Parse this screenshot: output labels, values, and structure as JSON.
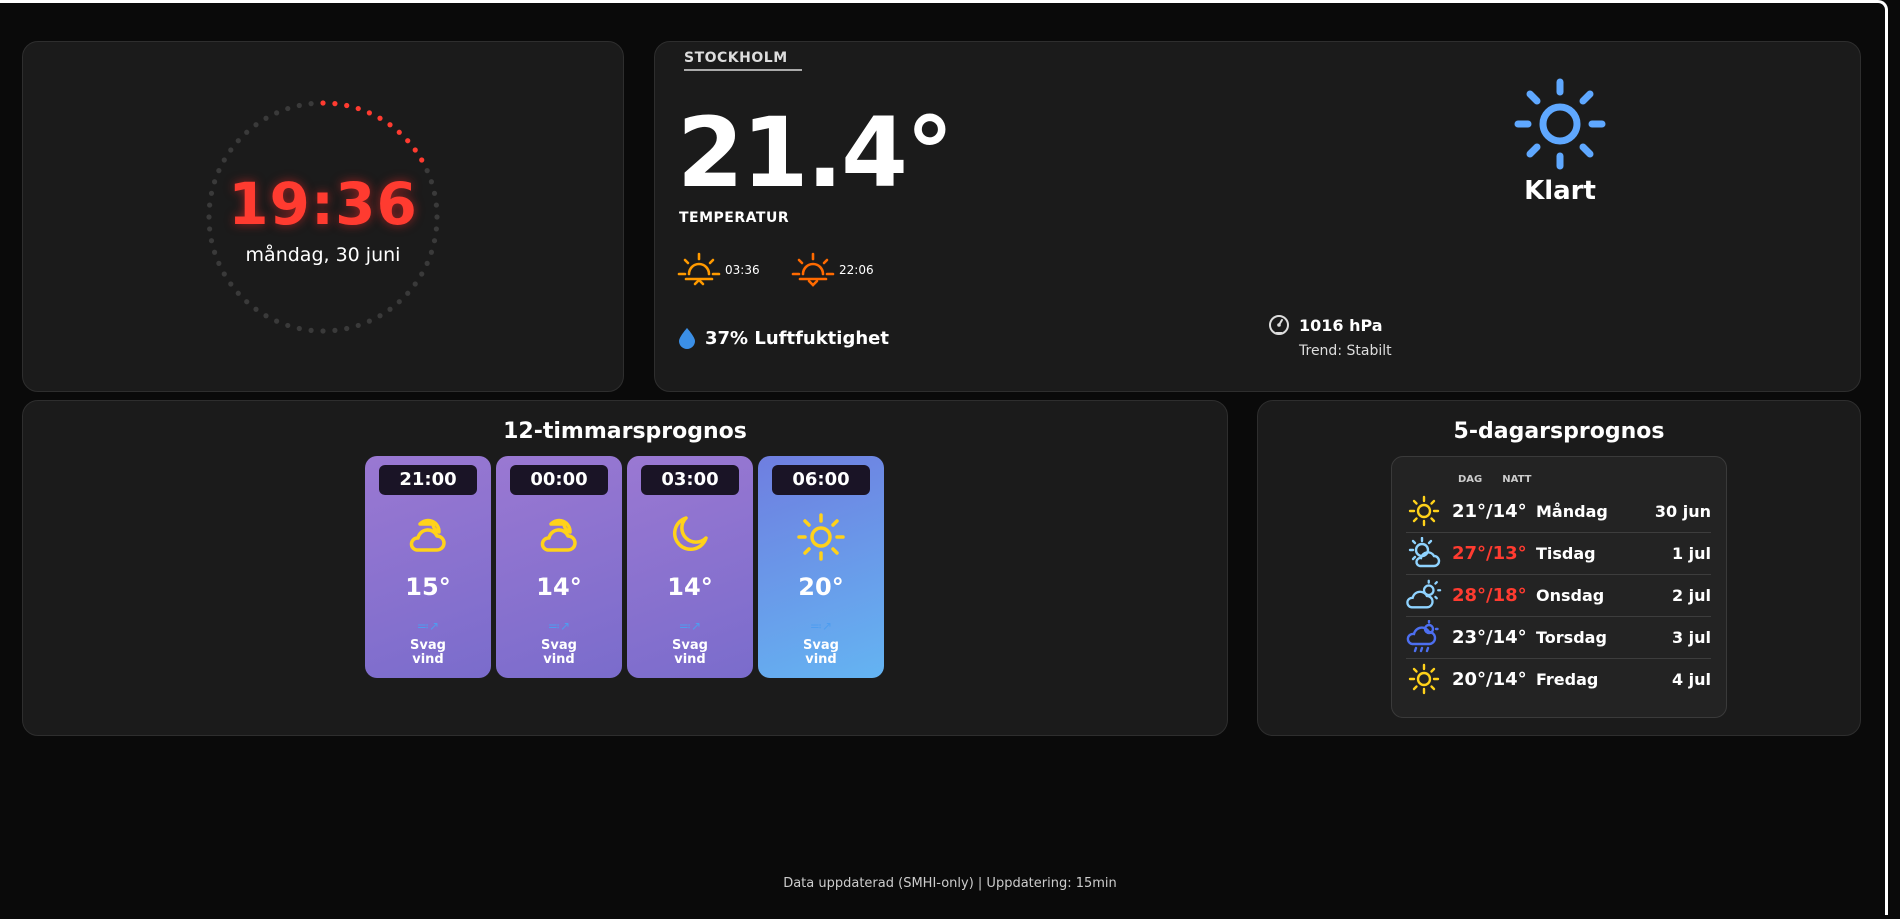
{
  "clock": {
    "time": "19:36",
    "date": "måndag, 30 juni",
    "accent_color": "#ff3b30"
  },
  "current": {
    "city": "STOCKHOLM",
    "temperature": "21.4°",
    "temperature_label": "TEMPERATUR",
    "sunrise": "03:36",
    "sunset": "22:06",
    "humidity": "37% Luftfuktighet",
    "pressure": "1016 hPa",
    "pressure_trend": "Trend: Stabilt",
    "condition": "Klart",
    "condition_icon": "sun-icon"
  },
  "hourly": {
    "title": "12-timmarsprognos",
    "items": [
      {
        "time": "21:00",
        "icon": "cloud-moon-icon",
        "temp": "15°",
        "wind_line1": "Svag",
        "wind_line2": "vind"
      },
      {
        "time": "00:00",
        "icon": "cloud-moon-icon",
        "temp": "14°",
        "wind_line1": "Svag",
        "wind_line2": "vind"
      },
      {
        "time": "03:00",
        "icon": "moon-icon",
        "temp": "14°",
        "wind_line1": "Svag",
        "wind_line2": "vind"
      },
      {
        "time": "06:00",
        "icon": "sun-icon",
        "temp": "20°",
        "wind_line1": "Svag",
        "wind_line2": "vind"
      }
    ]
  },
  "daily": {
    "title": "5-dagarsprognos",
    "day_label": "DAG",
    "night_label": "NATT",
    "items": [
      {
        "icon": "sun-icon",
        "temps": "21°/14°",
        "name": "Måndag",
        "date": "30 jun",
        "hot": false
      },
      {
        "icon": "partly-cloudy-icon",
        "temps": "27°/13°",
        "name": "Tisdag",
        "date": "1 jul",
        "hot": true
      },
      {
        "icon": "cloud-sun-icon",
        "temps": "28°/18°",
        "name": "Onsdag",
        "date": "2 jul",
        "hot": true
      },
      {
        "icon": "rain-cloud-icon",
        "temps": "23°/14°",
        "name": "Torsdag",
        "date": "3 jul",
        "hot": false
      },
      {
        "icon": "sun-icon",
        "temps": "20°/14°",
        "name": "Fredag",
        "date": "4 jul",
        "hot": false
      }
    ]
  },
  "footer": "Data uppdaterad (SMHI-only) | Uppdatering: 15min"
}
